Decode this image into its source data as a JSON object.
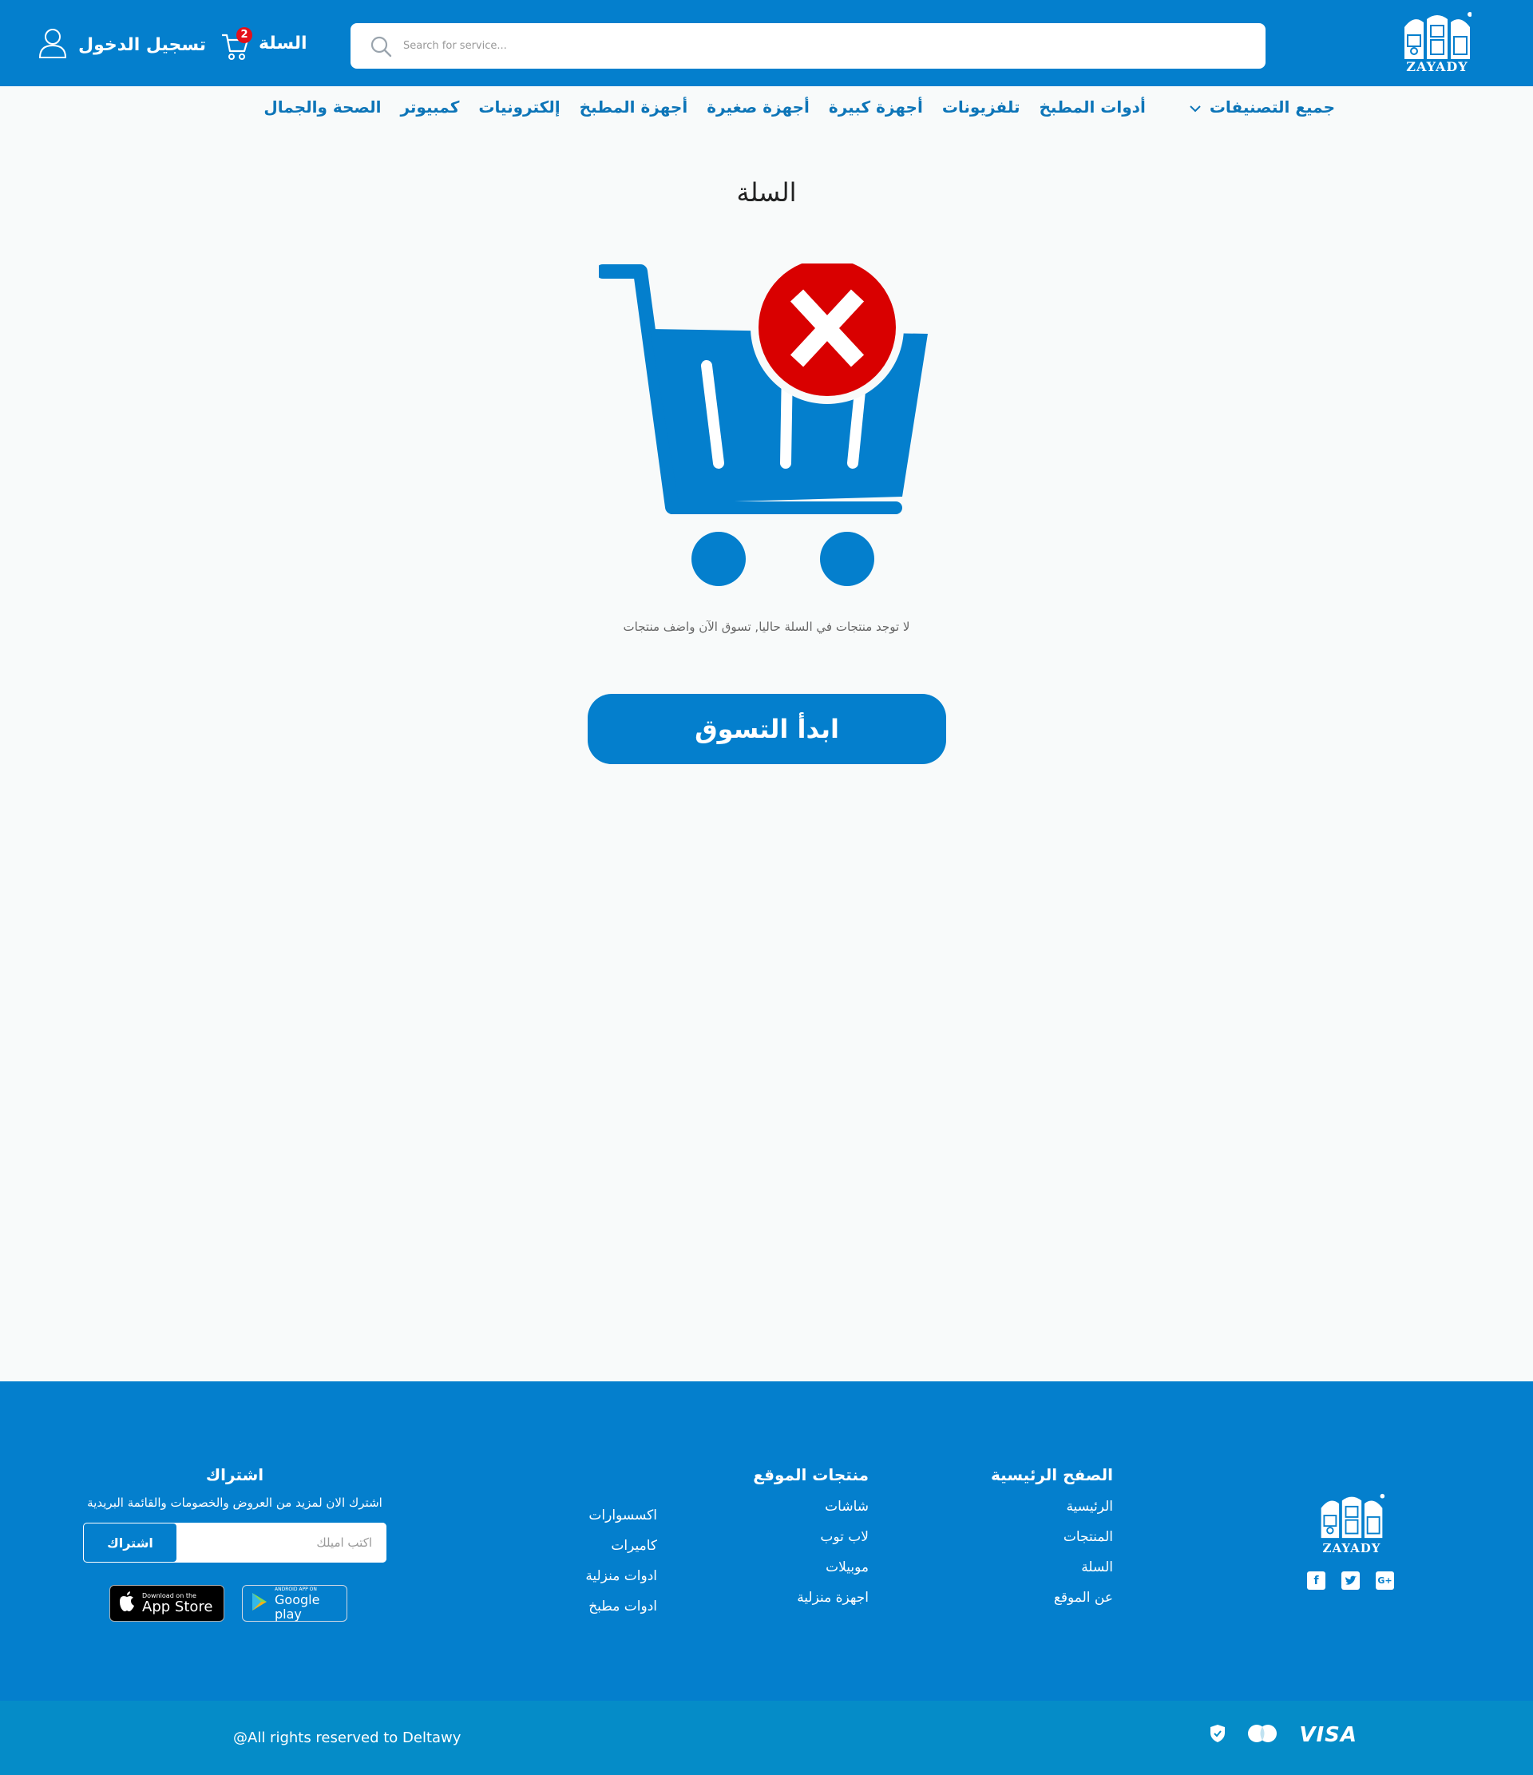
{
  "brand": {
    "logo_text": "ZAYADY"
  },
  "header": {
    "search_placeholder": "Search for service...",
    "cart_label": "السلة",
    "cart_count": "2",
    "login_label": "تسجيل الدخول"
  },
  "nav": {
    "all_categories": "جميع التصنيفات",
    "items": [
      "أدوات المطبخ",
      "تلفزيونات",
      "أجهزة كبيرة",
      "أجهزة صغيرة",
      "أجهزة المطبخ",
      "إلكترونيات",
      "كمبيوتر",
      "الصحة والجمال"
    ]
  },
  "main": {
    "title": "السلة",
    "empty_text": "لا توجد منتجات في السلة  حاليا, تسوق الآن واضف منتجات",
    "start_button": "ابدأ التسوق"
  },
  "footer": {
    "main_pages": {
      "title": "الصفح الرئيسية",
      "links": [
        "الرئيسية",
        "المنتجات",
        "السلة",
        "عن الموقع"
      ]
    },
    "site_products": {
      "title": "منتجات الموقع",
      "links_a": [
        "شاشات",
        "لاب توب",
        "موبيلات",
        "اجهزة منزلية"
      ],
      "links_b": [
        "اكسسوارات",
        "كاميرات",
        "ادوات منزلية",
        "ادوات مطبخ"
      ]
    },
    "subscribe": {
      "title": "اشتراك",
      "text": "اشترك الان لمزيد من العروض والخصومات والقائمة البريدية",
      "placeholder": "اكتب اميلك",
      "button": "اشتراك"
    },
    "stores": {
      "appstore_small": "Download on the",
      "appstore_big": "App Store",
      "googleplay_small": "ANDROID APP ON",
      "googleplay_big": "Google play"
    },
    "social": [
      "facebook-icon",
      "twitter-icon",
      "google-plus-icon"
    ],
    "copyright": "@All rights reserved to Deltawy",
    "payment_visa": "VISA"
  },
  "colors": {
    "primary": "#047fcd",
    "badge": "#e3101a",
    "empty_x": "#d90000",
    "footer_bottom": "#058cc8"
  }
}
